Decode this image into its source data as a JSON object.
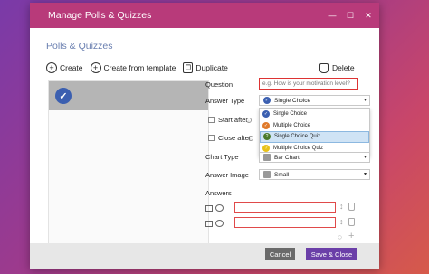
{
  "window": {
    "title": "Manage Polls & Quizzes",
    "controls": [
      "—",
      "☐",
      "✕"
    ]
  },
  "panel": {
    "title": "Polls & Quizzes"
  },
  "toolbar": {
    "create_label": "Create",
    "create_template_label": "Create from template",
    "duplicate_label": "Duplicate",
    "delete_label": "Delete"
  },
  "form": {
    "question_label": "Question",
    "question_placeholder": "e.g. How is your motivation level?",
    "answer_type_label": "Answer Type",
    "answer_type_value": "Single Choice",
    "start_after_label": "Start after",
    "close_after_label": "Close after",
    "chart_type_label": "Chart Type",
    "chart_type_value": "Bar Chart",
    "answer_image_label": "Answer Image",
    "answer_image_value": "Small",
    "answers_label": "Answers"
  },
  "dropdown": {
    "options": [
      {
        "label": "Single Choice",
        "icon_color": "#3b5fb0",
        "icon": "check-icon"
      },
      {
        "label": "Multiple Choice",
        "icon_color": "#e07a2a",
        "icon": "check-icon"
      },
      {
        "label": "Single Choice Quiz",
        "icon_color": "#4a7a2a",
        "icon": "question-icon"
      },
      {
        "label": "Multiple Choice Quiz",
        "icon_color": "#e8c21a",
        "icon": "question-icon"
      }
    ],
    "selected_index": 2
  },
  "footer": {
    "cancel_label": "Cancel",
    "save_label": "Save & Close"
  },
  "colors": {
    "titlebar": "#b83a7a",
    "accent": "#6b3fa8",
    "error_border": "#dd3333"
  }
}
